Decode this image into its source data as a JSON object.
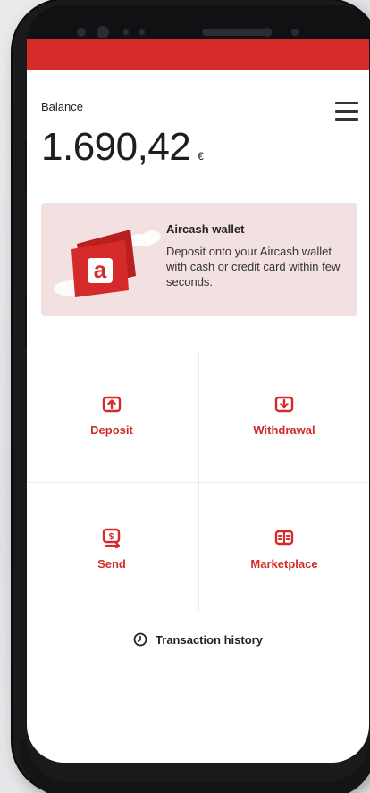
{
  "app": {
    "accent_color": "#d42a2a"
  },
  "header": {
    "balance_label": "Balance",
    "balance_value": "1.690,42",
    "currency_symbol": "€",
    "menu_icon": "hamburger-menu-icon"
  },
  "wallet_card": {
    "title": "Aircash wallet",
    "description": "Deposit onto your Aircash wallet with cash or credit card within few seconds.",
    "logo_letter": "a",
    "background_color": "#f3e1e1"
  },
  "actions": [
    {
      "label": "Deposit",
      "icon": "deposit-icon"
    },
    {
      "label": "Withdrawal",
      "icon": "withdrawal-icon"
    },
    {
      "label": "Send",
      "icon": "send-money-icon"
    },
    {
      "label": "Marketplace",
      "icon": "marketplace-icon"
    }
  ],
  "footer": {
    "history_label": "Transaction history",
    "history_icon": "clock-icon"
  }
}
